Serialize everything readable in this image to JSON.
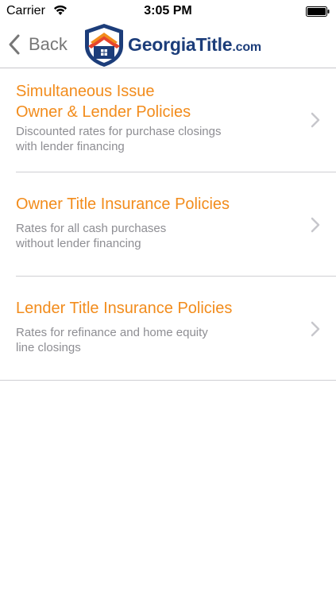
{
  "status_bar": {
    "carrier": "Carrier",
    "time": "3:05 PM",
    "wifi_icon": "wifi-icon",
    "battery_icon": "battery-icon"
  },
  "nav": {
    "back_label": "Back",
    "logo": {
      "part1": "Georgia",
      "part2": "Title",
      "part3": ".com"
    }
  },
  "items": [
    {
      "title_line1": "Simultaneous Issue",
      "title_line2": "Owner & Lender Policies",
      "desc_line1": "Discounted rates for purchase closings",
      "desc_line2": "with lender financing"
    },
    {
      "title_line1": "Owner Title Insurance Policies",
      "desc_line1": "Rates for all cash purchases",
      "desc_line2": "without lender financing"
    },
    {
      "title_line1": "Lender Title Insurance Policies",
      "desc_line1": "Rates for refinance and home equity",
      "desc_line2": "line closings"
    }
  ],
  "colors": {
    "accent_orange": "#f28c1c",
    "logo_blue": "#1c3d7a",
    "secondary_text": "#8e8e93"
  }
}
